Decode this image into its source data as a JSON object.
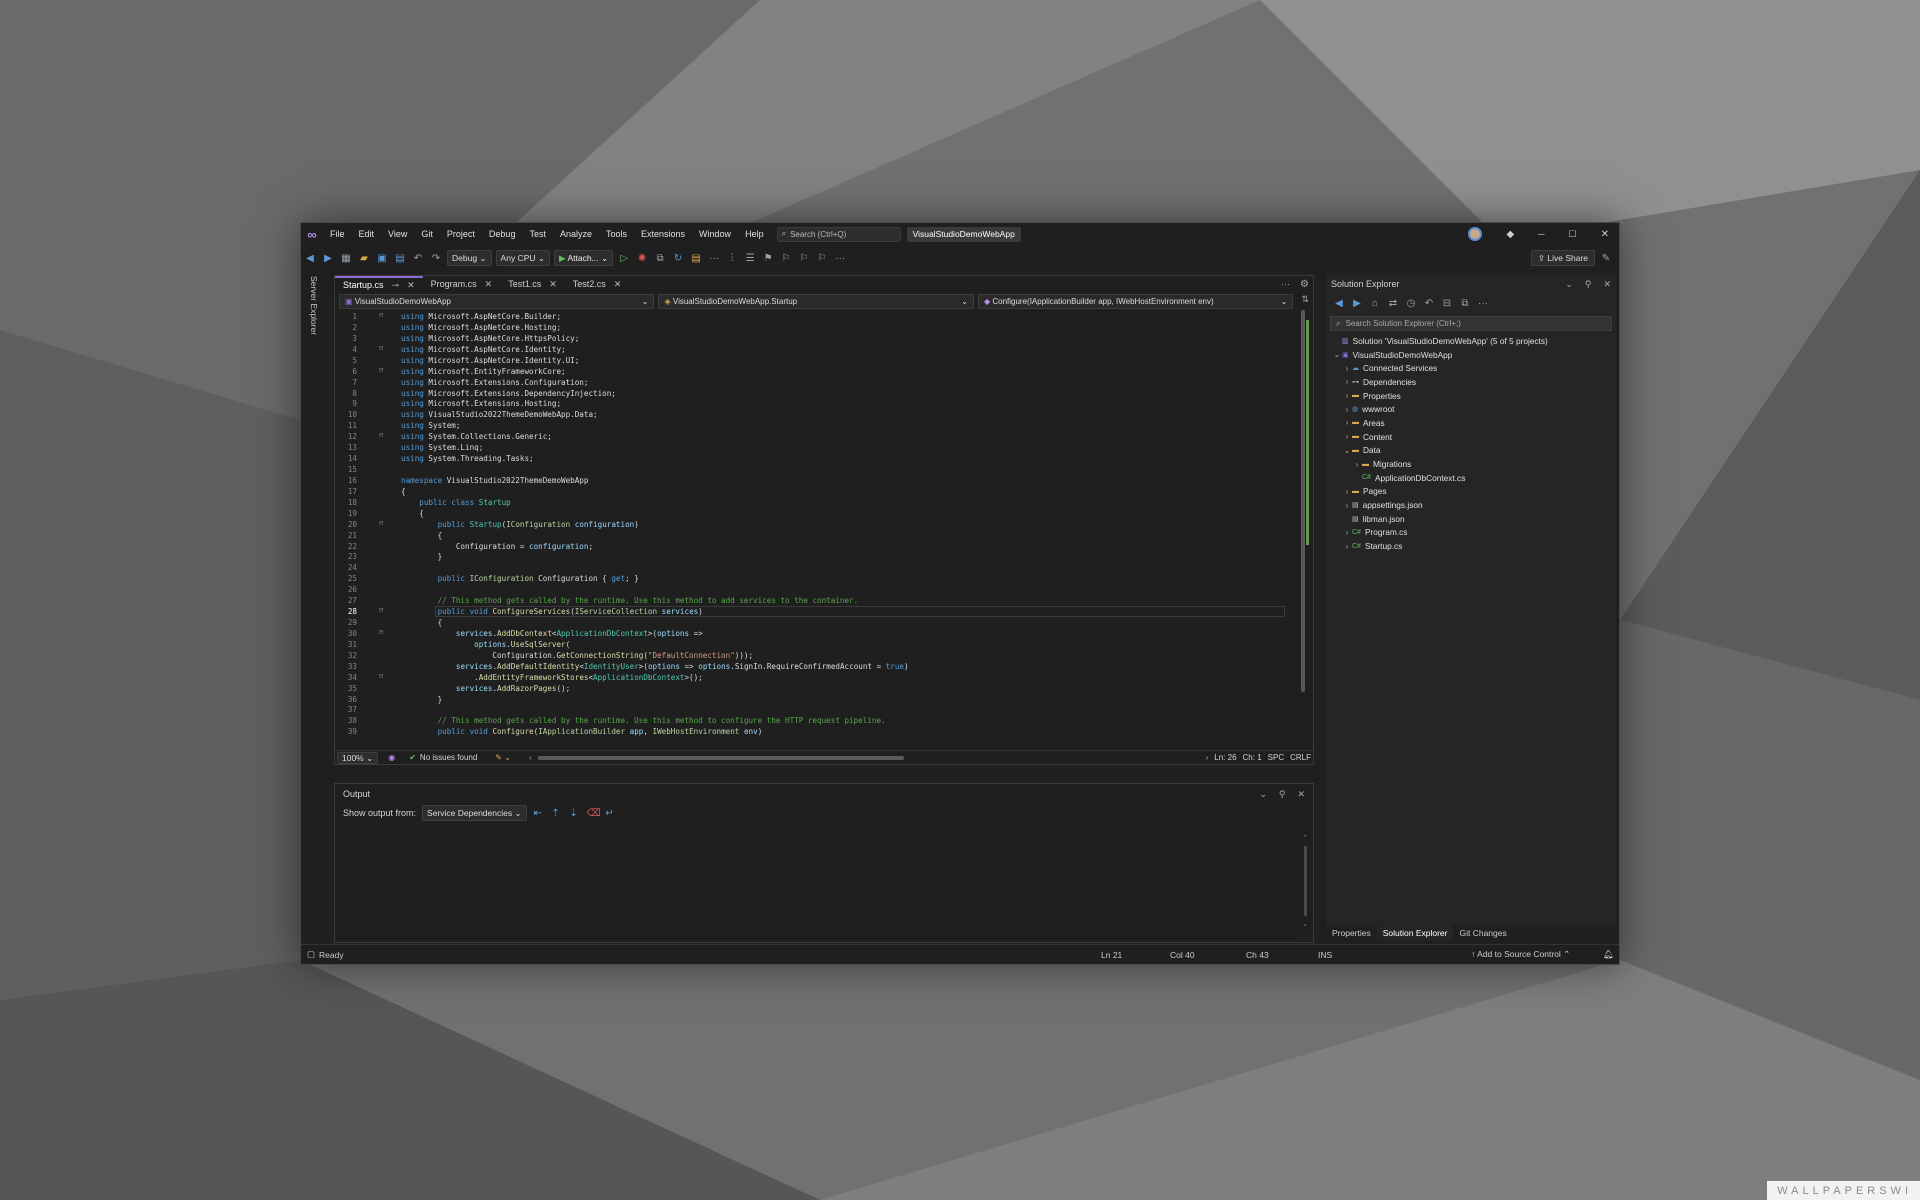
{
  "watermark": "WALLPAPERSWI",
  "menu": {
    "items": [
      "File",
      "Edit",
      "View",
      "Git",
      "Project",
      "Debug",
      "Test",
      "Analyze",
      "Tools",
      "Extensions",
      "Window",
      "Help"
    ],
    "search_placeholder": "Search (Ctrl+Q)",
    "solution_title": "VisualStudioDemoWebApp"
  },
  "toolbar": {
    "config": "Debug",
    "platform": "Any CPU",
    "attach": "Attach...",
    "live_share": "Live Share"
  },
  "left_strip": {
    "server_explorer": "Server Explorer"
  },
  "editor": {
    "tabs": [
      {
        "label": "Startup.cs",
        "active": true
      },
      {
        "label": "Program.cs"
      },
      {
        "label": "Test1.cs"
      },
      {
        "label": "Test2.cs"
      }
    ],
    "nav": {
      "project": "VisualStudioDemoWebApp",
      "type": "VisualStudioDemoWebApp.Startup",
      "member": "Configure(IApplicationBuilder app, IWebHostEnvironment env)"
    },
    "zoom": "100%",
    "issues": "No issues found",
    "position": {
      "ln": "Ln: 26",
      "ch": "Ch: 1",
      "spc": "SPC",
      "eol": "CRLF"
    },
    "lines": [
      "<span class=kw>using</span> Microsoft.AspNetCore.Builder;",
      "<span class=kw>using</span> Microsoft.AspNetCore.Hosting;",
      "<span class=kw>using</span> Microsoft.AspNetCore.HttpsPolicy;",
      "<span class=kw>using</span> Microsoft.AspNetCore.Identity;",
      "<span class=kw>using</span> Microsoft.AspNetCore.Identity.UI;",
      "<span class=kw>using</span> Microsoft.EntityFrameworkCore;",
      "<span class=kw>using</span> Microsoft.Extensions.Configuration;",
      "<span class=kw>using</span> Microsoft.Extensions.DependencyInjection;",
      "<span class=kw>using</span> Microsoft.Extensions.Hosting;",
      "<span class=kw>using</span> VisualStudio2022ThemeDemoWebApp.Data;",
      "<span class=kw>using</span> System;",
      "<span class=kw>using</span> System.Collections.Generic;",
      "<span class=kw>using</span> System.Linq;",
      "<span class=kw>using</span> System.Threading.Tasks;",
      "",
      "<span class=kw>namespace</span> VisualStudio2022ThemeDemoWebApp",
      "{",
      "    <span class=kw>public class</span> <span class=ty>Startup</span>",
      "    {",
      "        <span class=kw>public</span> <span class=ty>Startup</span>(<span class=it>IConfiguration</span> <span class=pa>configuration</span>)",
      "        {",
      "            Configuration = <span class=pa>configuration</span>;",
      "        }",
      "",
      "        <span class=kw>public</span> <span class=it>IConfiguration</span> Configuration { <span class=kw>get</span>; }",
      "",
      "        <span class=cm>// This method gets called by the runtime. Use this method to add services to the container.</span>",
      "        <span class=kw>public void</span> <span class=fn>ConfigureServices</span>(<span class=it>IServiceCollection</span> <span class=pa>services</span>)",
      "        {",
      "            <span class=pa>services</span>.<span class=fn>AddDbContext</span>&lt;<span class=ty>ApplicationDbContext</span>&gt;(<span class=pa>options</span> =&gt;",
      "                <span class=pa>options</span>.<span class=fn>UseSqlServer</span>(",
      "                    Configuration.<span class=fn>GetConnectionString</span>(<span class=str>\"DefaultConnection\"</span>)));",
      "            <span class=pa>services</span>.<span class=fn>AddDefaultIdentity</span>&lt;<span class=ty>IdentityUser</span>&gt;(<span class=pa>options</span> =&gt; <span class=pa>options</span>.SignIn.RequireConfirmedAccount = <span class=kw>true</span>)",
      "                .<span class=fn>AddEntityFrameworkStores</span>&lt;<span class=ty>ApplicationDbContext</span>&gt;();",
      "            <span class=pa>services</span>.<span class=fn>AddRazorPages</span>();",
      "        }",
      "",
      "        <span class=cm>// This method gets called by the runtime. Use this method to configure the HTTP request pipeline.</span>",
      "        <span class=kw>public void</span> <span class=fn>Configure</span>(<span class=it>IApplicationBuilder</span> <span class=pa>app</span>, <span class=it>IWebHostEnvironment</span> <span class=pa>env</span>)"
    ],
    "current_line": 28
  },
  "output": {
    "title": "Output",
    "show_from_label": "Show output from:",
    "source": "Service Dependencies"
  },
  "solution_explorer": {
    "title": "Solution Explorer",
    "search_placeholder": "Search Solution Explorer (Ctrl+;)",
    "items": [
      {
        "label": "Solution 'VisualStudioDemoWebApp' (5 of 5 projects)",
        "depth": 0,
        "chev": "",
        "icon": "sln"
      },
      {
        "label": "VisualStudioDemoWebApp",
        "depth": 0,
        "chev": "⌄",
        "icon": "proj"
      },
      {
        "label": "Connected Services",
        "depth": 1,
        "chev": "›",
        "icon": "svc"
      },
      {
        "label": "Dependencies",
        "depth": 1,
        "chev": "›",
        "icon": "dep"
      },
      {
        "label": "Properties",
        "depth": 1,
        "chev": "›",
        "icon": "folder"
      },
      {
        "label": "wwwroot",
        "depth": 1,
        "chev": "›",
        "icon": "globe"
      },
      {
        "label": "Areas",
        "depth": 1,
        "chev": "›",
        "icon": "folder"
      },
      {
        "label": "Content",
        "depth": 1,
        "chev": "›",
        "icon": "folder"
      },
      {
        "label": "Data",
        "depth": 1,
        "chev": "⌄",
        "icon": "folder"
      },
      {
        "label": "Migrations",
        "depth": 2,
        "chev": "›",
        "icon": "folder"
      },
      {
        "label": "ApplicationDbContext.cs",
        "depth": 2,
        "chev": "",
        "icon": "cs"
      },
      {
        "label": "Pages",
        "depth": 1,
        "chev": "›",
        "icon": "folder"
      },
      {
        "label": "appsettings.json",
        "depth": 1,
        "chev": "›",
        "icon": "json"
      },
      {
        "label": "libman.json",
        "depth": 1,
        "chev": "",
        "icon": "json"
      },
      {
        "label": "Program.cs",
        "depth": 1,
        "chev": "›",
        "icon": "cs"
      },
      {
        "label": "Startup.cs",
        "depth": 1,
        "chev": "›",
        "icon": "cs"
      }
    ],
    "bottom_tabs": [
      "Properties",
      "Solution Explorer",
      "Git Changes"
    ]
  },
  "status": {
    "ready": "Ready",
    "ln": "Ln 21",
    "col": "Col 40",
    "ch": "Ch 43",
    "ins": "INS",
    "source_control": "Add to Source Control"
  }
}
